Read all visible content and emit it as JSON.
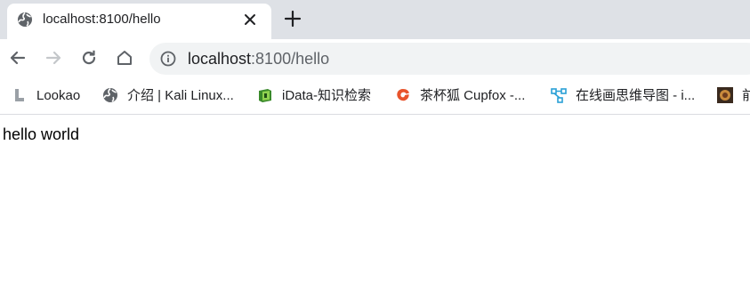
{
  "tab": {
    "title": "localhost:8100/hello",
    "favicon": "globe-icon",
    "close_icon": "close-icon"
  },
  "new_tab_icon": "plus-icon",
  "nav": {
    "back_icon": "arrow-left-icon",
    "forward_icon": "arrow-right-icon",
    "reload_icon": "reload-icon",
    "home_icon": "home-icon"
  },
  "omnibox": {
    "info_icon": "info-icon",
    "url_host": "localhost",
    "url_rest": ":8100/hello"
  },
  "bookmarks": [
    {
      "label": "Lookao",
      "icon": "lookao-logo-icon"
    },
    {
      "label": "介绍 | Kali Linux...",
      "icon": "globe-icon"
    },
    {
      "label": "iData-知识检索",
      "icon": "idata-book-icon"
    },
    {
      "label": "茶杯狐 Cupfox -...",
      "icon": "cupfox-logo-icon"
    },
    {
      "label": "在线画思维导图 - i...",
      "icon": "mindmap-icon"
    },
    {
      "label": "前",
      "icon": "thumbnail-icon"
    }
  ],
  "page": {
    "body_text": "hello world"
  },
  "colors": {
    "tabstrip": "#dee1e6",
    "omnibox": "#f1f3f4",
    "icon": "#5f6368",
    "idata": "#3a8a2a",
    "cupfox": "#e8542c",
    "mindmap": "#2aa0d6"
  }
}
